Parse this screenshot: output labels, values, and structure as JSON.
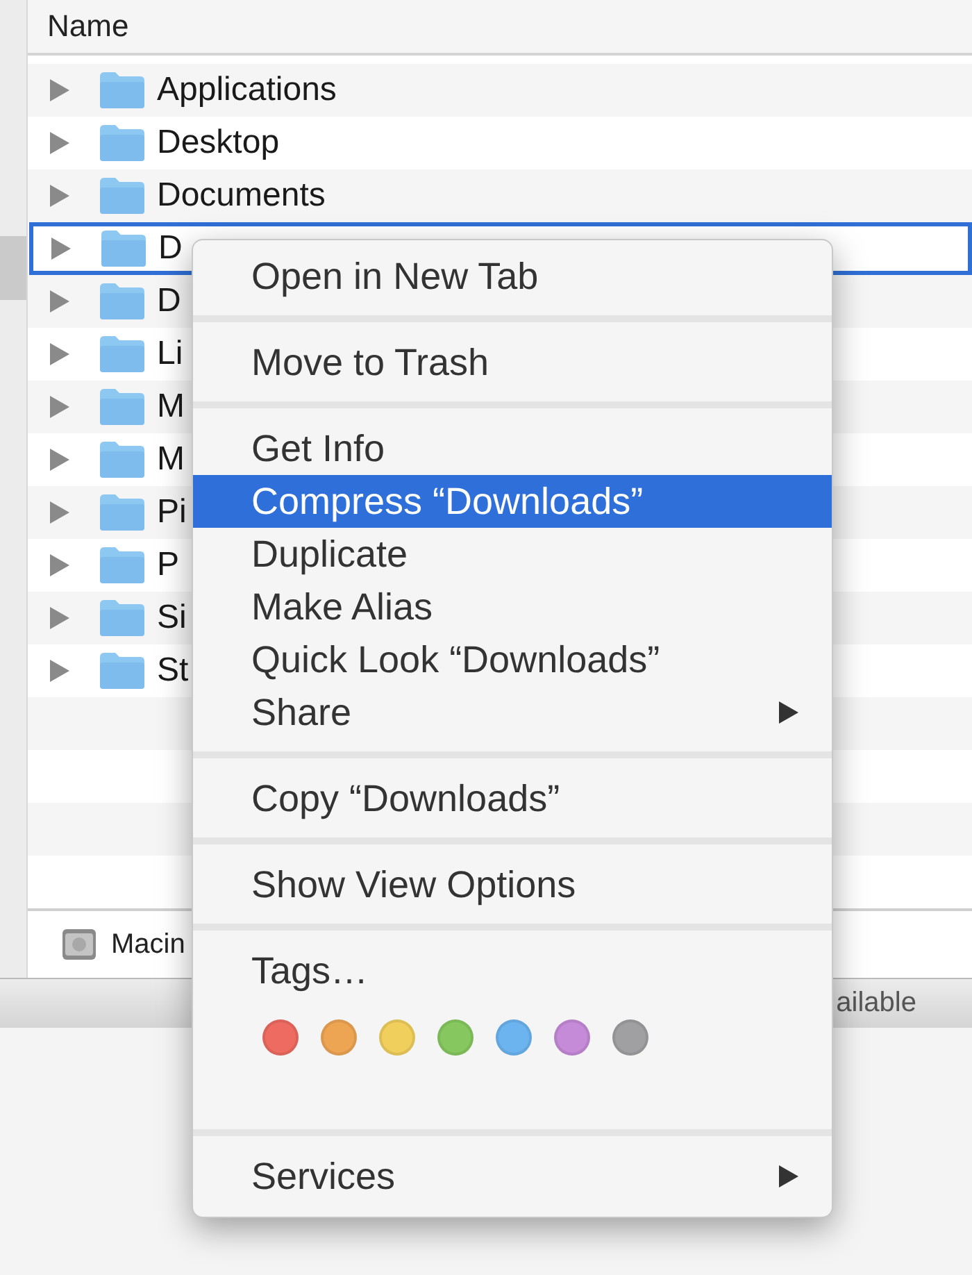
{
  "file_list": {
    "column_header": "Name",
    "rows": [
      {
        "name": "Applications",
        "selected": false
      },
      {
        "name": "Desktop",
        "selected": false
      },
      {
        "name": "Documents",
        "selected": false
      },
      {
        "name": "D",
        "selected": true
      },
      {
        "name": "D",
        "selected": false
      },
      {
        "name": "Li",
        "selected": false
      },
      {
        "name": "M",
        "selected": false
      },
      {
        "name": "M",
        "selected": false
      },
      {
        "name": "Pi",
        "selected": false
      },
      {
        "name": "P",
        "selected": false
      },
      {
        "name": "Si",
        "selected": false
      },
      {
        "name": "St",
        "selected": false
      }
    ]
  },
  "path_bar": {
    "label": "Macin"
  },
  "status_bar": {
    "text": "ailable"
  },
  "context_menu": {
    "sections": [
      {
        "kind": "items",
        "items": [
          {
            "label": "Open in New Tab",
            "selected": false,
            "submenu": false
          }
        ]
      },
      {
        "kind": "items",
        "items": [
          {
            "label": "Move to Trash",
            "selected": false,
            "submenu": false
          }
        ]
      },
      {
        "kind": "items",
        "items": [
          {
            "label": "Get Info",
            "selected": false,
            "submenu": false
          },
          {
            "label": "Compress “Downloads”",
            "selected": true,
            "submenu": false
          },
          {
            "label": "Duplicate",
            "selected": false,
            "submenu": false
          },
          {
            "label": "Make Alias",
            "selected": false,
            "submenu": false
          },
          {
            "label": "Quick Look “Downloads”",
            "selected": false,
            "submenu": false
          },
          {
            "label": "Share",
            "selected": false,
            "submenu": true
          }
        ]
      },
      {
        "kind": "items",
        "items": [
          {
            "label": "Copy “Downloads”",
            "selected": false,
            "submenu": false
          }
        ]
      },
      {
        "kind": "items",
        "items": [
          {
            "label": "Show View Options",
            "selected": false,
            "submenu": false
          }
        ]
      },
      {
        "kind": "tags",
        "label": "Tags…",
        "tags": [
          {
            "color": "#ee6b61"
          },
          {
            "color": "#eea553"
          },
          {
            "color": "#f0cf5d"
          },
          {
            "color": "#86c85f"
          },
          {
            "color": "#6cb4f0"
          },
          {
            "color": "#c58ad8"
          },
          {
            "color": "#a0a0a2"
          }
        ]
      },
      {
        "kind": "items",
        "items": [
          {
            "label": "Services",
            "selected": false,
            "submenu": true
          }
        ]
      }
    ]
  }
}
